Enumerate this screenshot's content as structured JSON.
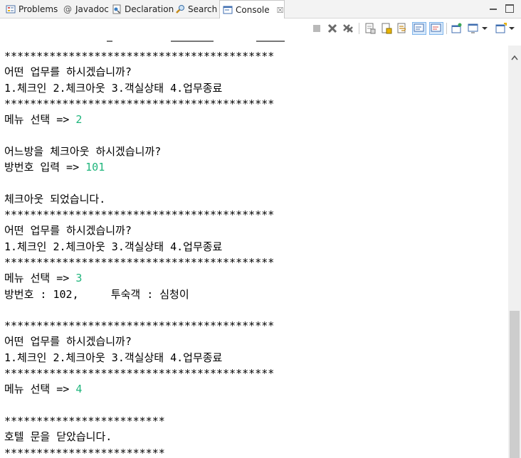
{
  "tabs": [
    {
      "label": "Problems",
      "icon": "problems-icon"
    },
    {
      "label": "Javadoc",
      "icon": "javadoc-icon"
    },
    {
      "label": "Declaration",
      "icon": "declaration-icon"
    },
    {
      "label": "Search",
      "icon": "search-icon"
    },
    {
      "label": "Console",
      "icon": "console-icon",
      "active": true,
      "close": "☒"
    }
  ],
  "toolbar": {
    "icons": [
      "terminate-icon",
      "remove-launch-icon",
      "remove-all-terminated-icon",
      "clear-console-icon",
      "scroll-lock-icon",
      "word-wrap-icon",
      "show-on-stdout-icon",
      "show-on-stderr-icon",
      "pin-console-icon",
      "display-console-icon",
      "open-console-icon"
    ]
  },
  "console": {
    "lines": [
      {
        "text": "******************************************"
      },
      {
        "text": "어떤 업무를 하시겠습니까?"
      },
      {
        "text": "1.체크인 2.체크아웃 3.객실상태 4.업무종료"
      },
      {
        "text": "******************************************"
      },
      {
        "text": "메뉴 선택 => ",
        "input": "2"
      },
      {
        "text": ""
      },
      {
        "text": "어느방을 체크아웃 하시겠습니까?"
      },
      {
        "text": "방번호 입력 => ",
        "input": "101"
      },
      {
        "text": ""
      },
      {
        "text": "체크아웃 되었습니다."
      },
      {
        "text": "******************************************"
      },
      {
        "text": "어떤 업무를 하시겠습니까?"
      },
      {
        "text": "1.체크인 2.체크아웃 3.객실상태 4.업무종료"
      },
      {
        "text": "******************************************"
      },
      {
        "text": "메뉴 선택 => ",
        "input": "3"
      },
      {
        "text": "방번호 : 102,     투숙객 : 심청이"
      },
      {
        "text": ""
      },
      {
        "text": "******************************************"
      },
      {
        "text": "어떤 업무를 하시겠습니까?"
      },
      {
        "text": "1.체크인 2.체크아웃 3.객실상태 4.업무종료"
      },
      {
        "text": "******************************************"
      },
      {
        "text": "메뉴 선택 => ",
        "input": "4"
      },
      {
        "text": ""
      },
      {
        "text": "*************************"
      },
      {
        "text": "호텔 문을 닫았습니다."
      },
      {
        "text": "*************************"
      }
    ]
  },
  "colors": {
    "input": "#1fb57c",
    "tabbar": "#f3f3f3",
    "scroll_thumb": "#cdcdcd"
  }
}
